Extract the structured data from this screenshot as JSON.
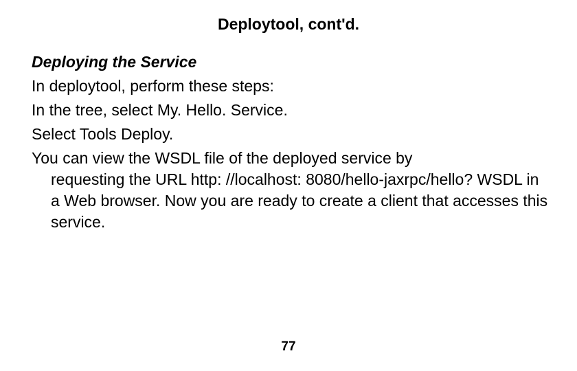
{
  "slide": {
    "title": "Deploytool, cont'd.",
    "section_heading": "Deploying the Service",
    "line1": "In deploytool, perform these steps:",
    "line2": "In the tree, select My. Hello. Service.",
    "line3": "Select Tools Deploy.",
    "para_first": "You can view the WSDL file of the deployed service by",
    "para_rest": "requesting the URL http: //localhost: 8080/hello-jaxrpc/hello? WSDL in a Web browser. Now you are ready to create a client that accesses this service.",
    "page_number": "77"
  }
}
